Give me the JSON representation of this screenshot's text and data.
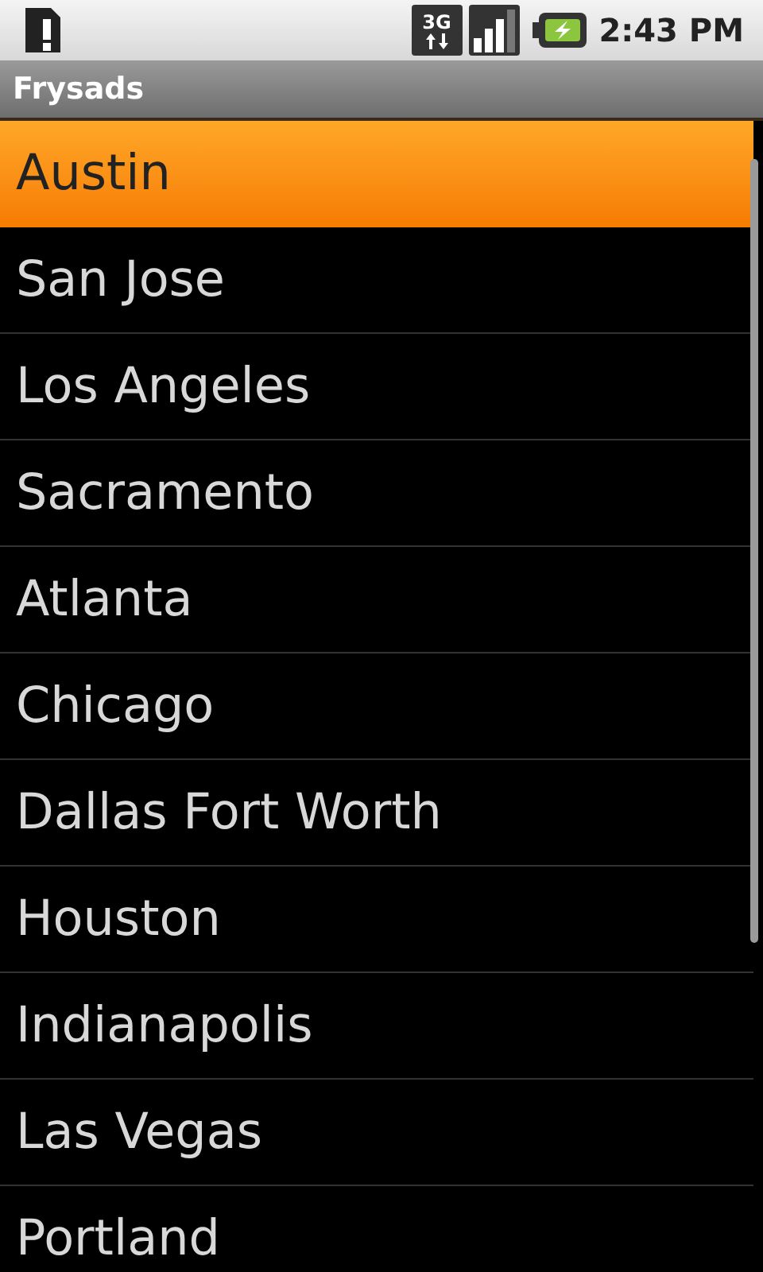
{
  "status_bar": {
    "network": "3G",
    "time": "2:43 PM"
  },
  "title_bar": {
    "title": "Frysads"
  },
  "cities": [
    {
      "name": "Austin",
      "selected": true
    },
    {
      "name": "San Jose",
      "selected": false
    },
    {
      "name": "Los Angeles",
      "selected": false
    },
    {
      "name": "Sacramento",
      "selected": false
    },
    {
      "name": "Atlanta",
      "selected": false
    },
    {
      "name": "Chicago",
      "selected": false
    },
    {
      "name": "Dallas Fort Worth",
      "selected": false
    },
    {
      "name": "Houston",
      "selected": false
    },
    {
      "name": "Indianapolis",
      "selected": false
    },
    {
      "name": "Las Vegas",
      "selected": false
    },
    {
      "name": "Portland",
      "selected": false
    }
  ]
}
